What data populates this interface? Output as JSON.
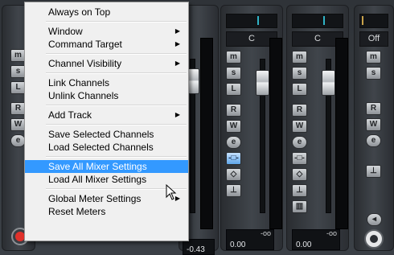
{
  "menu": {
    "items": [
      {
        "label": "Always on Top",
        "has_submenu": false
      },
      {
        "label": "Window",
        "has_submenu": true
      },
      {
        "label": "Command Target",
        "has_submenu": true
      },
      {
        "label": "Channel Visibility",
        "has_submenu": true
      },
      {
        "label": "Link Channels",
        "has_submenu": false
      },
      {
        "label": "Unlink Channels",
        "has_submenu": false
      },
      {
        "label": "Add Track",
        "has_submenu": true
      },
      {
        "label": "Save Selected Channels",
        "has_submenu": false
      },
      {
        "label": "Load Selected Channels",
        "has_submenu": false
      },
      {
        "label": "Save All Mixer Settings",
        "has_submenu": false,
        "highlighted": true
      },
      {
        "label": "Load All Mixer Settings",
        "has_submenu": false
      },
      {
        "label": "Global Meter Settings",
        "has_submenu": true
      },
      {
        "label": "Reset Meters",
        "has_submenu": false
      }
    ],
    "submenu_arrow": "▶",
    "highlight_color": "#3399ff"
  },
  "channels": [
    {
      "name": "C",
      "buttons": [
        "m",
        "s",
        "L",
        "R",
        "W",
        "e"
      ],
      "fader_db": "-oo",
      "value": "0.00"
    },
    {
      "name": "C",
      "buttons": [
        "m",
        "s",
        "L",
        "R",
        "W",
        "e"
      ],
      "fader_db": "-oo",
      "value": "0.00"
    },
    {
      "name": "Off",
      "buttons": [
        "m",
        "s",
        "R",
        "W",
        "e"
      ],
      "fader_db": "",
      "value": ""
    }
  ],
  "left_strip": {
    "value": "-0.43"
  },
  "button_labels": {
    "m": "m",
    "s": "s",
    "L": "L",
    "R": "R",
    "W": "W",
    "e": "e"
  },
  "colors": {
    "routing_tick": "#2fb3c6",
    "record_button": "#e0312b"
  }
}
